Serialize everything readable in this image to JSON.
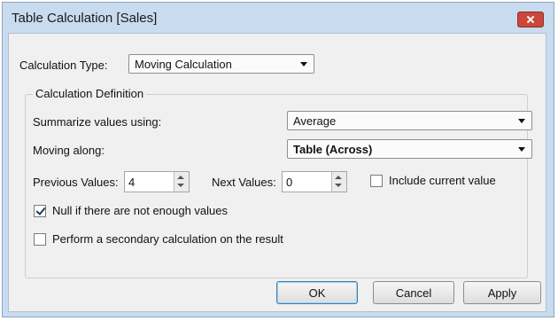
{
  "window": {
    "title": "Table Calculation [Sales]"
  },
  "calculation_type": {
    "label": "Calculation Type:",
    "value": "Moving Calculation"
  },
  "definition": {
    "group_title": "Calculation Definition",
    "summarize": {
      "label": "Summarize values using:",
      "value": "Average"
    },
    "moving_along": {
      "label": "Moving along:",
      "value": "Table (Across)"
    },
    "previous": {
      "label": "Previous Values:",
      "value": "4"
    },
    "next": {
      "label": "Next Values:",
      "value": "0"
    },
    "include_current": {
      "label": "Include current value",
      "checked": false
    },
    "null_if": {
      "label": "Null if there are not enough values",
      "checked": true
    },
    "secondary": {
      "label": "Perform a secondary calculation on the result",
      "checked": false
    }
  },
  "buttons": {
    "ok": "OK",
    "cancel": "Cancel",
    "apply": "Apply"
  }
}
